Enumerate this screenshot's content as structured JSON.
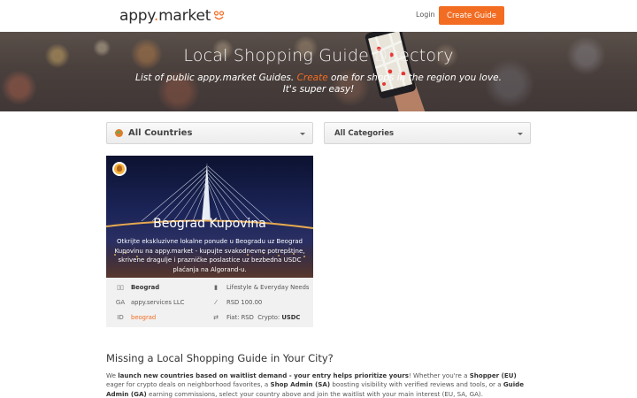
{
  "navbar": {
    "logo_text": "appy",
    "logo_dot": ".",
    "logo_suffix": "market",
    "login_label": "Login",
    "create_label": "Create Guide"
  },
  "hero": {
    "title": "Local Shopping Guide Directory",
    "subtitle_before": "List of public appy.market Guides. ",
    "subtitle_create": "Create",
    "subtitle_after": " one for shops in the region you love.",
    "subtitle_line2": "It's super easy!"
  },
  "filters": {
    "country": "All Countries",
    "category": "All Categories"
  },
  "card": {
    "title": "Beograd Kupovina",
    "description": "Otkrijte ekskluzivne lokalne ponude u Beogradu uz Beograd Kupovinu na appy.market - kupujte svakodnevne potrepštine, skrivene dragulje i prazničke poslastice uz bezbedna USDC plaćanja na Algorand-u.",
    "city": "Beograd",
    "category": "Lifestyle & Everyday Needs",
    "ga_label": "GA",
    "ga_value": "appy.services LLC",
    "fee": "RSD 100.00",
    "id_label": "ID",
    "id_value": "beograd",
    "fiat_label": "Fiat: RSD",
    "crypto_label": "Crypto:",
    "crypto_value": "USDC"
  },
  "missing": {
    "title": "Missing a Local Shopping Guide in Your City?",
    "p1": "We ",
    "b1": "launch new countries based on waitlist demand - your entry helps prioritize yours",
    "p2": "! Whether you're a ",
    "b2": "Shopper (EU)",
    "p3": " eager for crypto deals on neighborhood favorites, a ",
    "b3": "Shop Admin (SA)",
    "p4": " boosting visibility with verified reviews and tools, or a ",
    "b4": "Guide Admin (GA)",
    "p5": " earning commissions, select your country above and join the waitlist with your main interest (EU, SA, GA)."
  },
  "colors": {
    "brand_orange": "#f26c22"
  }
}
